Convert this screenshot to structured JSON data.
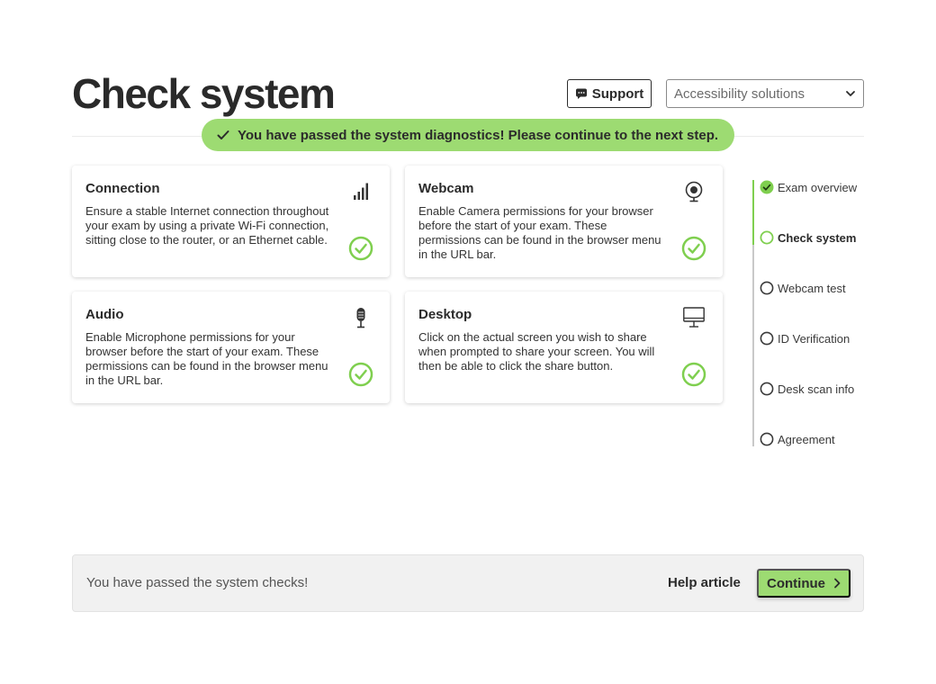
{
  "header": {
    "title": "Check system",
    "support_label": "Support",
    "accessibility_label": "Accessibility solutions"
  },
  "banner": {
    "text": "You have passed the system diagnostics! Please continue to the next step."
  },
  "cards": [
    {
      "title": "Connection",
      "icon": "signal-bars-icon",
      "status": "passed",
      "description": "Ensure a stable Internet connection throughout your exam by using a private Wi-Fi connection, sitting close to the router, or an Ethernet cable."
    },
    {
      "title": "Webcam",
      "icon": "webcam-icon",
      "status": "passed",
      "description": "Enable Camera permissions for your browser before the start of your exam. These permissions can be found in the browser menu in the URL bar."
    },
    {
      "title": "Audio",
      "icon": "microphone-icon",
      "status": "passed",
      "description": "Enable Microphone permissions for your browser before the start of your exam. These permissions can be found in the browser menu in the URL bar."
    },
    {
      "title": "Desktop",
      "icon": "monitor-icon",
      "status": "passed",
      "description": "Click on the actual screen you wish to share when prompted to share your screen. You will then be able to click the share button."
    }
  ],
  "steps": [
    {
      "label": "Exam overview",
      "state": "complete"
    },
    {
      "label": "Check system",
      "state": "current"
    },
    {
      "label": "Webcam test",
      "state": "pending"
    },
    {
      "label": "ID Verification",
      "state": "pending"
    },
    {
      "label": "Desk scan info",
      "state": "pending"
    },
    {
      "label": "Agreement",
      "state": "pending"
    }
  ],
  "footer": {
    "status_text": "You have passed the system checks!",
    "help_label": "Help article",
    "continue_label": "Continue"
  },
  "colors": {
    "accent_green": "#9ddb72",
    "check_green": "#7fcf4f",
    "text_dark": "#2b2b2b"
  }
}
